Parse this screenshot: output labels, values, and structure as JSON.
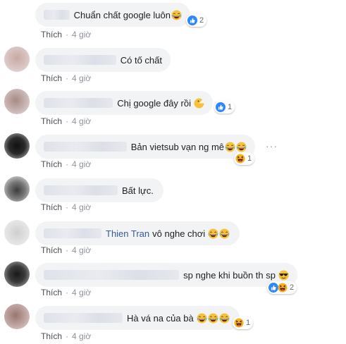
{
  "colors": {
    "bubble": "#f2f3f5",
    "link": "#385898",
    "meta": "#90949c",
    "like_blue": "#2d88ff"
  },
  "comments": [
    {
      "text": "Chuẩn chất google luôn",
      "emoji": [
        "laughing-tears"
      ],
      "reaction_count": "2",
      "like_label": "Thích",
      "time": "4 giờ"
    },
    {
      "text": "Có tố chất",
      "emoji": [],
      "reaction_count": "",
      "like_label": "Thích",
      "time": "4 giờ"
    },
    {
      "text": "Chị google đây rồi",
      "emoji": [
        "pacman"
      ],
      "reaction_count": "1",
      "like_label": "Thích",
      "time": "4 giờ"
    },
    {
      "text": "Bản vietsub vạn ng mê",
      "emoji": [
        "laughing-tears",
        "laughing-tears"
      ],
      "reaction_count": "1",
      "like_label": "Thích",
      "time": "4 giờ"
    },
    {
      "text": "Bất lực.",
      "emoji": [],
      "reaction_count": "",
      "like_label": "Thích",
      "time": "4 giờ"
    },
    {
      "mention": "Thien Tran",
      "text": "vô nghe chơi",
      "emoji": [
        "laughing-tears",
        "laughing-tears"
      ],
      "reaction_count": "",
      "like_label": "Thích",
      "time": "4 giờ"
    },
    {
      "text": "sp nghe khi buồn th sp",
      "emoji": [
        "sunglasses"
      ],
      "reaction_count": "2",
      "like_label": "Thích",
      "time": "4 giờ"
    },
    {
      "text": "Hà vá na của bà",
      "emoji": [
        "laughing-tears",
        "laughing-tears",
        "laughing-tears"
      ],
      "reaction_count": "1",
      "like_label": "Thích",
      "time": "4 giờ"
    }
  ],
  "more_options": "···"
}
